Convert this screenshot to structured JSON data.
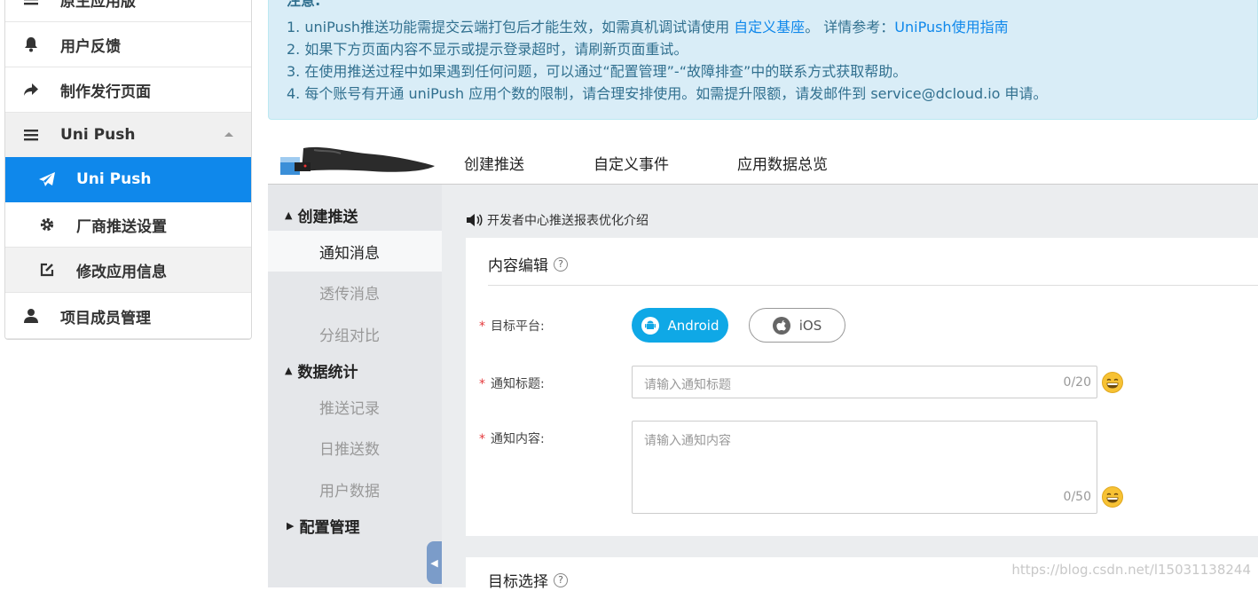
{
  "sidebar": {
    "items": [
      {
        "label": "原生应用版",
        "icon": "menu-icon"
      },
      {
        "label": "用户反馈",
        "icon": "bell-icon"
      },
      {
        "label": "制作发行页面",
        "icon": "share-arrow-icon"
      },
      {
        "label": "Uni Push",
        "icon": "menu-icon"
      },
      {
        "label": "Uni Push",
        "icon": "paper-plane-icon"
      },
      {
        "label": "厂商推送设置",
        "icon": "gear-icon"
      },
      {
        "label": "修改应用信息",
        "icon": "edit-icon"
      },
      {
        "label": "项目成员管理",
        "icon": "user-icon"
      }
    ]
  },
  "notice": {
    "title": "注意:",
    "line1_pre": "1. uniPush推送功能需提交云端打包后才能生效，如需真机调试请使用",
    "line1_link1": "自定义基座",
    "line1_mid": "。 详情参考：",
    "line1_link2": "UniPush使用指南",
    "line2": "2. 如果下方页面内容不显示或提示登录超时，请刷新页面重试。",
    "line3": "3. 在使用推送过程中如果遇到任何问题，可以通过“配置管理”-“故障排查”中的联系方式获取帮助。",
    "line4": "4. 每个账号有开通 uniPush 应用个数的限制，请合理安排使用。如需提升限额，请发邮件到 service@dcloud.io 申请。"
  },
  "app_tabs": [
    "创建推送",
    "自定义事件",
    "应用数据总览"
  ],
  "menu2": {
    "group1": "创建推送",
    "group1_items": [
      "通知消息",
      "透传消息",
      "分组对比"
    ],
    "group2": "数据统计",
    "group2_items": [
      "推送记录",
      "日推送数",
      "用户数据"
    ],
    "group3": "配置管理"
  },
  "main": {
    "intro": "开发者中心推送报表优化介绍",
    "section1_title": "内容编辑",
    "section2_title": "目标选择",
    "platform_label": "目标平台:",
    "android_label": "Android",
    "ios_label": "iOS",
    "title_label": "通知标题:",
    "title_placeholder": "请输入通知标题",
    "title_count": "0/20",
    "content_label": "通知内容:",
    "content_placeholder": "请输入通知内容",
    "content_count": "0/50",
    "required_mark": "*",
    "help_mark": "?"
  },
  "watermark": "https://blog.csdn.net/l15031138244",
  "colors": {
    "accent": "#0f88eb",
    "android": "#0fa8e6",
    "notice_bg": "#d9edf7"
  }
}
